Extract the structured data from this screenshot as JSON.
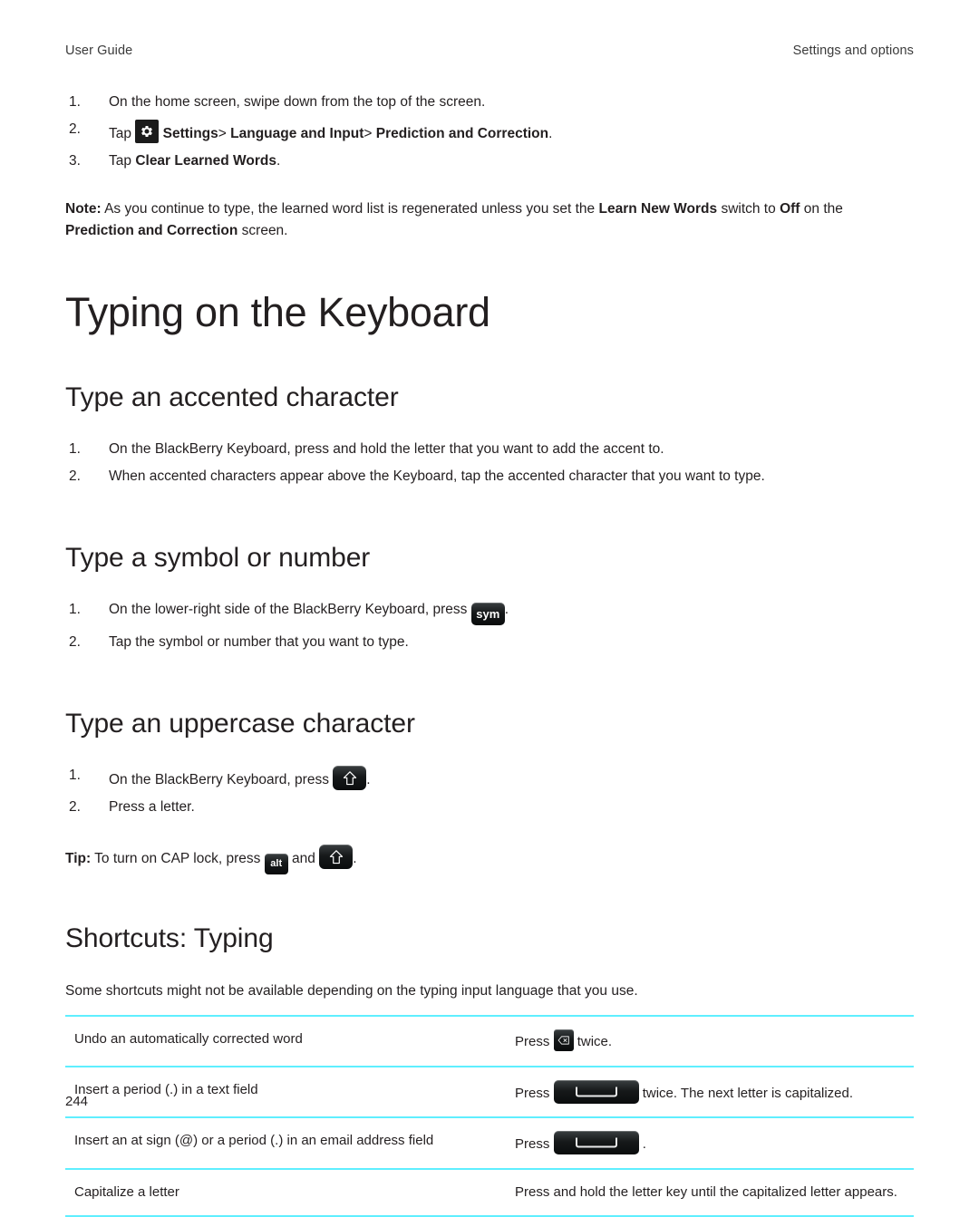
{
  "header": {
    "left": "User Guide",
    "right": "Settings and options"
  },
  "clear_learned_words": {
    "step1": "On the home screen, swipe down from the top of the screen.",
    "step2_prefix": "Tap",
    "step2_settings": "Settings",
    "step2_sep1": ">",
    "step2_language": "Language and Input",
    "step2_sep2": ">",
    "step2_prediction": "Prediction and Correction",
    "step2_period": ".",
    "step3_prefix": "Tap",
    "step3_bold": "Clear Learned Words",
    "step3_period": ".",
    "note_label": "Note:",
    "note_text1": "As you continue to type, the learned word list is regenerated unless you set the",
    "note_bold1": "Learn New Words",
    "note_text2": "switch to",
    "note_bold2": "Off",
    "note_text3": "on the",
    "note_bold3": "Prediction and Correction",
    "note_text4": "screen."
  },
  "main_heading": "Typing on the Keyboard",
  "accented": {
    "heading": "Type an accented character",
    "step1": "On the BlackBerry Keyboard, press and hold the letter that you want to add the accent to.",
    "step2": "When accented characters appear above the Keyboard, tap the accented character that you want to type."
  },
  "symbol": {
    "heading": "Type a symbol or number",
    "step1_text": "On the lower-right side of the BlackBerry Keyboard, press",
    "step1_key": "sym",
    "step1_period": ".",
    "step2": "Tap the symbol or number that you want to type."
  },
  "uppercase": {
    "heading": "Type an uppercase character",
    "step1_text": "On the BlackBerry Keyboard, press",
    "step1_period": ".",
    "step2": "Press a letter.",
    "tip_label": "Tip:",
    "tip_text1": "To turn on CAP lock, press",
    "tip_key_alt": "alt",
    "tip_text2": "and",
    "tip_period": "."
  },
  "shortcuts": {
    "heading": "Shortcuts: Typing",
    "intro": "Some shortcuts might not be available depending on the typing input language that you use.",
    "rows": [
      {
        "action": "Undo an automatically corrected word",
        "press_label": "Press",
        "key": "delete-key",
        "suffix": "twice."
      },
      {
        "action": "Insert a period (.) in a text field",
        "press_label": "Press",
        "key": "space-key",
        "suffix": "twice. The next letter is capitalized."
      },
      {
        "action": "Insert an at sign (@) or a period (.) in an email address field",
        "press_label": "Press",
        "key": "space-key",
        "suffix": "."
      },
      {
        "action": "Capitalize a letter",
        "press_label": "",
        "key": "",
        "suffix": "Press and hold the letter key until the capitalized letter appears."
      }
    ]
  },
  "folio": "244",
  "colors": {
    "rule": "#5fefff",
    "text": "#231f20",
    "key_dark": "#16191a"
  }
}
